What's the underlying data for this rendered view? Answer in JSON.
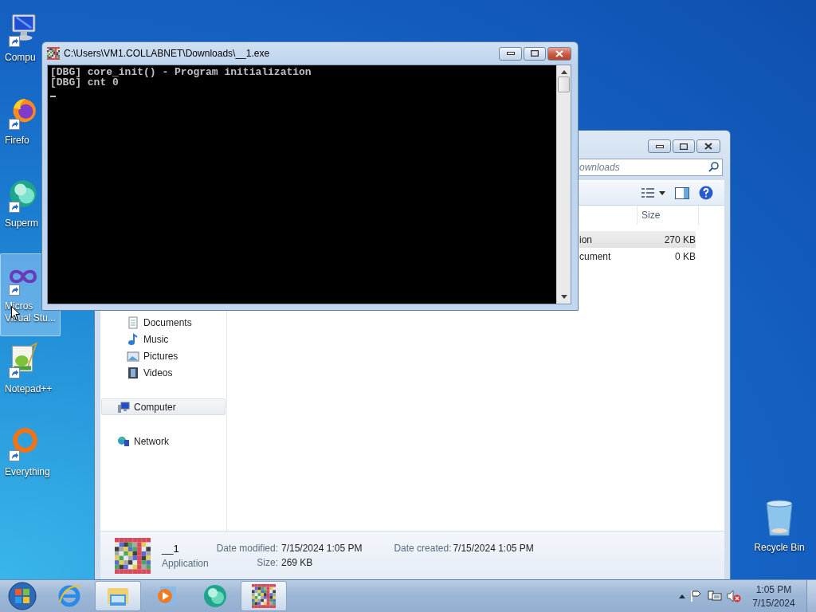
{
  "desktop": {
    "icons": [
      {
        "kind": "computer",
        "label": "Compu",
        "selected": false
      },
      {
        "kind": "browser",
        "label": "Firefo",
        "selected": false
      },
      {
        "kind": "sphere",
        "label": "Superm",
        "selected": false
      },
      {
        "kind": "infinity",
        "label": "Micros",
        "label_2": "Visual Stu...",
        "selected": true
      },
      {
        "kind": "notepad",
        "label": "Notepad++",
        "selected": false
      },
      {
        "kind": "ring",
        "label": "Everything",
        "selected": false
      }
    ],
    "recycle_bin": {
      "label": "Recycle Bin"
    }
  },
  "console_window": {
    "title": "C:\\Users\\VM1.COLLABNET\\Downloads\\__1.exe",
    "lines": [
      "[DBG] core_init() - Program initialization",
      "[DBG] cnt 0"
    ]
  },
  "explorer_window": {
    "search": {
      "placeholder": "ownloads"
    },
    "columns": [
      "Size"
    ],
    "rows": [
      {
        "type": "ion",
        "size": "270 KB",
        "selected": true
      },
      {
        "type": "cument",
        "size": "0 KB",
        "selected": false
      }
    ],
    "nav": {
      "libraries": [
        {
          "kind": "documents",
          "label": "Documents",
          "selected": false
        },
        {
          "kind": "music",
          "label": "Music",
          "selected": false
        },
        {
          "kind": "pictures",
          "label": "Pictures",
          "selected": false
        },
        {
          "kind": "videos",
          "label": "Videos",
          "selected": false
        }
      ],
      "computer": {
        "label": "Computer",
        "selected": true
      },
      "network": {
        "label": "Network",
        "selected": false
      }
    },
    "details": {
      "name": "__1",
      "type": "Application",
      "properties": [
        [
          {
            "label": "Date modified:",
            "value": "7/15/2024 1:05 PM"
          },
          {
            "label": "Size:",
            "value": "269 KB"
          }
        ],
        [
          {
            "label": "Date created:",
            "value": "7/15/2024 1:05 PM"
          }
        ]
      ]
    }
  },
  "taskbar": {
    "apps": [
      {
        "kind": "ie",
        "active": false
      },
      {
        "kind": "explorer",
        "active": true
      },
      {
        "kind": "media",
        "active": false
      },
      {
        "kind": "sphere",
        "active": false
      },
      {
        "kind": "program",
        "active": true
      }
    ],
    "clock": {
      "time": "1:05 PM",
      "date": "7/15/2024"
    }
  }
}
